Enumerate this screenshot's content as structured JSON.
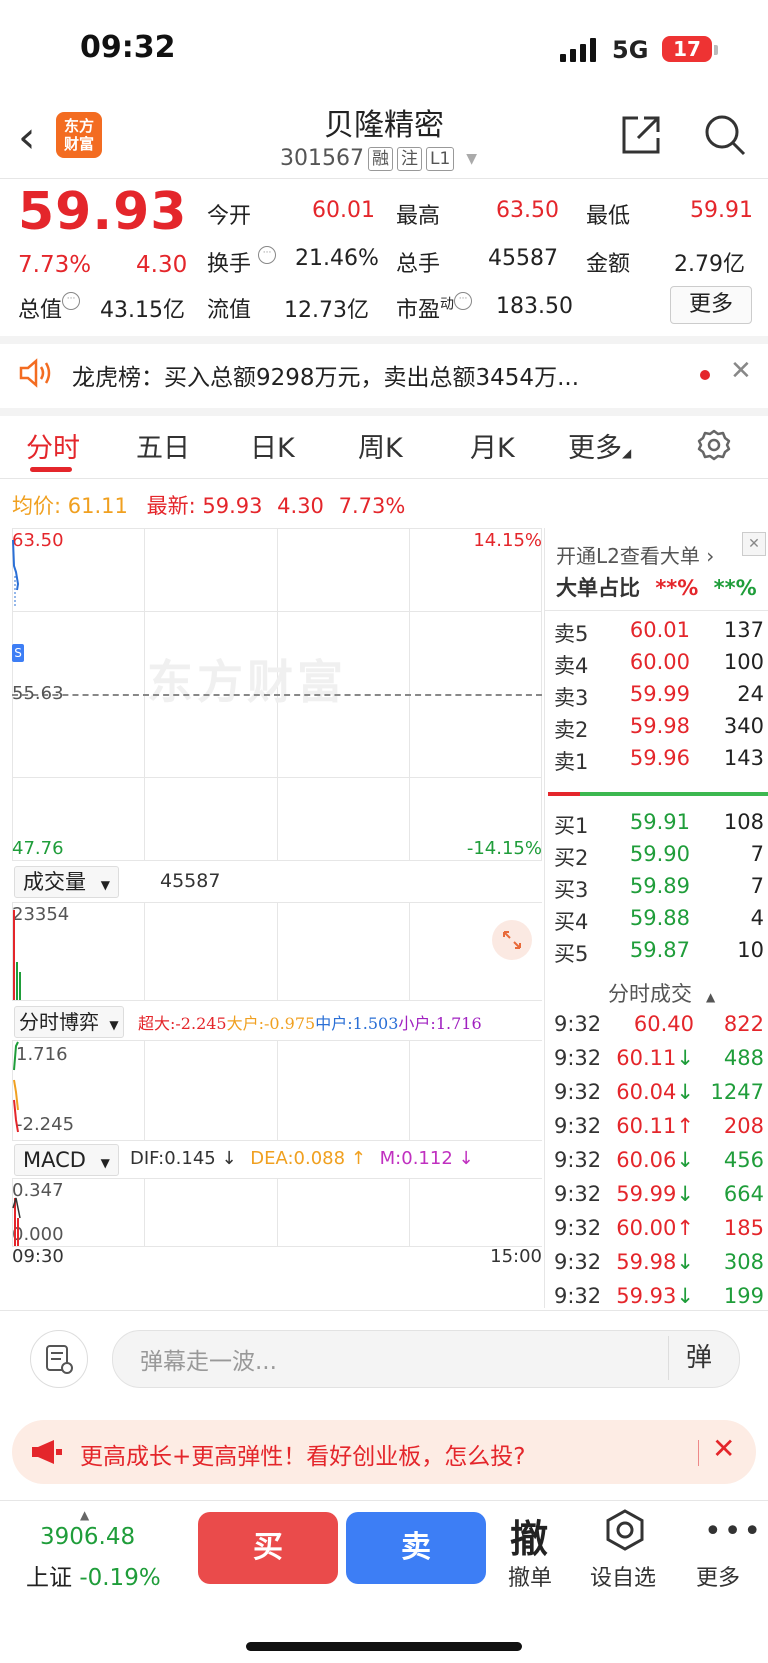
{
  "status": {
    "time": "09:32",
    "network": "5G",
    "battery": "17"
  },
  "header": {
    "title": "贝隆精密",
    "code": "301567",
    "tags": [
      "融",
      "注",
      "L1"
    ],
    "logo_line1": "东方",
    "logo_line2": "财富"
  },
  "quote": {
    "price": "59.93",
    "change_pct": "7.73%",
    "change": "4.30",
    "open_label": "今开",
    "open": "60.01",
    "high_label": "最高",
    "high": "63.50",
    "low_label": "最低",
    "low": "59.91",
    "turnover_label": "换手",
    "turnover": "21.46%",
    "volume_label": "总手",
    "volume": "45587",
    "amount_label": "金额",
    "amount": "2.79亿",
    "mktcap_label": "总值",
    "mktcap": "43.15亿",
    "float_label": "流值",
    "float": "12.73亿",
    "pe_label": "市盈",
    "pe_sup": "动",
    "pe": "183.50",
    "more": "更多"
  },
  "dragon": {
    "text": "龙虎榜：买入总额9298万元，卖出总额3454万..."
  },
  "tabs": [
    "分时",
    "五日",
    "日K",
    "周K",
    "月K",
    "更多"
  ],
  "avg": {
    "avg_label": "均价:",
    "avg": "61.11",
    "latest_label": "最新:",
    "latest": "59.93",
    "chg": "4.30",
    "pct": "7.73%"
  },
  "chart": {
    "max": "63.50",
    "max_pct": "14.15%",
    "mid": "55.63",
    "min": "47.76",
    "min_pct": "-14.15%",
    "watermark": "东方财富",
    "vol_sel": "成交量",
    "vol_val": "45587",
    "vol_max": "23354",
    "game_sel": "分时博弈",
    "game_super": "超大:-2.245",
    "game_big": "大户:-0.975",
    "game_mid": "中户:1.503",
    "game_small": "小户:1.716",
    "game_max": "1.716",
    "game_min": "-2.245",
    "macd_sel": "MACD",
    "dif": "DIF:0.145 ↓",
    "dea": "DEA:0.088 ↑",
    "m": "M:0.112 ↓",
    "macd_max": "0.347",
    "macd_min": "0.000",
    "t_start": "09:30",
    "t_end": "15:00"
  },
  "orderbook": {
    "l2": "开通L2查看大单 ›",
    "big_label": "大单占比",
    "big_red": "**%",
    "big_green": "**%",
    "sells": [
      {
        "label": "卖5",
        "price": "60.01",
        "vol": "137"
      },
      {
        "label": "卖4",
        "price": "60.00",
        "vol": "100"
      },
      {
        "label": "卖3",
        "price": "59.99",
        "vol": "24"
      },
      {
        "label": "卖2",
        "price": "59.98",
        "vol": "340"
      },
      {
        "label": "卖1",
        "price": "59.96",
        "vol": "143"
      }
    ],
    "buys": [
      {
        "label": "买1",
        "price": "59.91",
        "vol": "108"
      },
      {
        "label": "买2",
        "price": "59.90",
        "vol": "7"
      },
      {
        "label": "买3",
        "price": "59.89",
        "vol": "7"
      },
      {
        "label": "买4",
        "price": "59.88",
        "vol": "4"
      },
      {
        "label": "买5",
        "price": "59.87",
        "vol": "10"
      }
    ],
    "trades_label": "分时成交",
    "trades": [
      {
        "time": "9:32",
        "price": "60.40",
        "vol": "822",
        "dir": ""
      },
      {
        "time": "9:32",
        "price": "60.11",
        "vol": "488",
        "dir": "↓"
      },
      {
        "time": "9:32",
        "price": "60.04",
        "vol": "1247",
        "dir": "↓"
      },
      {
        "time": "9:32",
        "price": "60.11",
        "vol": "208",
        "dir": "↑"
      },
      {
        "time": "9:32",
        "price": "60.06",
        "vol": "456",
        "dir": "↓"
      },
      {
        "time": "9:32",
        "price": "59.99",
        "vol": "664",
        "dir": "↓"
      },
      {
        "time": "9:32",
        "price": "60.00",
        "vol": "185",
        "dir": "↑"
      },
      {
        "time": "9:32",
        "price": "59.98",
        "vol": "308",
        "dir": "↓"
      },
      {
        "time": "9:32",
        "price": "59.93",
        "vol": "199",
        "dir": "↓"
      }
    ]
  },
  "comment": {
    "placeholder": "弹幕走一波...",
    "danmu": "弹"
  },
  "promo": {
    "text": "更高成长+更高弹性！看好创业板，怎么投?"
  },
  "bottom": {
    "index_value": "3906.48",
    "index_name": "上证",
    "index_pct": "-0.19%",
    "buy": "买",
    "sell": "卖",
    "cancel_glyph": "撤",
    "cancel": "撤单",
    "watch": "设自选",
    "more": "更多"
  },
  "colors": {
    "up": "#e4262b",
    "down": "#1f9d3a",
    "buy_btn": "#ea4b4b",
    "sell_btn": "#3d7ef5",
    "brand": "#f36c21"
  }
}
